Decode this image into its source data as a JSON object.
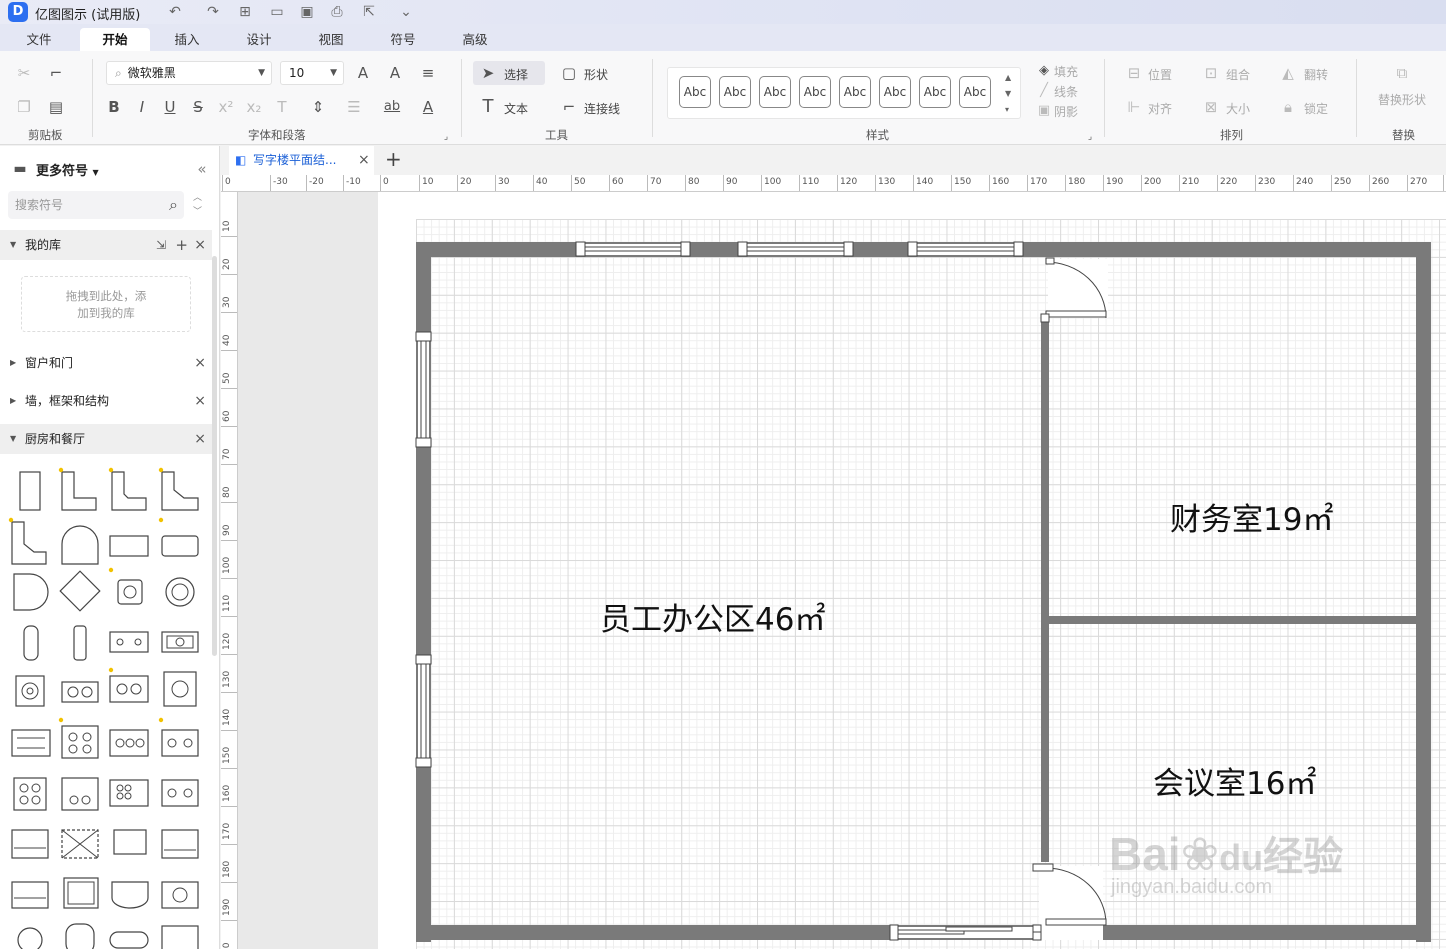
{
  "app": {
    "title": "亿图图示 (试用版)"
  },
  "menu": {
    "tabs": [
      "文件",
      "开始",
      "插入",
      "设计",
      "视图",
      "符号",
      "高级"
    ],
    "active": "开始"
  },
  "ribbon": {
    "font_name": "微软雅黑",
    "font_size": "10",
    "groups": {
      "clipboard": "剪贴板",
      "font_para": "字体和段落",
      "tools": "工具",
      "styles": "样式",
      "arrange": "排列",
      "replace": "替换"
    },
    "tools": {
      "select": "选择",
      "shape": "形状",
      "text": "文本",
      "connector": "连接线"
    },
    "style_sample": "Abc",
    "style_count": 8,
    "fill": "填充",
    "line": "线条",
    "shadow": "阴影",
    "position": "位置",
    "group": "组合",
    "flip": "翻转",
    "align": "对齐",
    "size": "大小",
    "lock": "锁定",
    "replace_shape": "替换形状"
  },
  "sidebar": {
    "title": "更多符号",
    "search_placeholder": "搜索符号",
    "my_library": "我的库",
    "drop_hint_1": "拖拽到此处，添",
    "drop_hint_2": "加到我的库",
    "categories": [
      "窗户和门",
      "墙，框架和结构",
      "厨房和餐厅"
    ]
  },
  "document": {
    "tab_title": "写字楼平面结..."
  },
  "rulers": {
    "h_ticks": [
      "0",
      "-30",
      "-20",
      "-10",
      "0",
      "10",
      "20",
      "30",
      "40",
      "50",
      "60",
      "70",
      "80",
      "90",
      "100",
      "110",
      "120",
      "130",
      "140",
      "150",
      "160",
      "170",
      "180",
      "190",
      "200",
      "210",
      "220",
      "230",
      "240",
      "250",
      "260",
      "270",
      "28"
    ],
    "v_ticks": [
      "10",
      "20",
      "30",
      "40",
      "50",
      "60",
      "70",
      "80",
      "90",
      "100",
      "110",
      "120",
      "130",
      "140",
      "150",
      "160",
      "170",
      "180",
      "190",
      "20"
    ]
  },
  "floorplan": {
    "rooms": [
      {
        "label": "员工办公区46㎡"
      },
      {
        "label": "财务室19㎡"
      },
      {
        "label": "会议室16㎡"
      }
    ]
  },
  "watermark": {
    "brand": "Bai",
    "brand2": "du",
    "cn": "经验",
    "url": "jingyan.baidu.com"
  },
  "colors": {
    "accent": "#2d6ff0",
    "wall": "#7a7a7a",
    "grid": "#dadada"
  }
}
